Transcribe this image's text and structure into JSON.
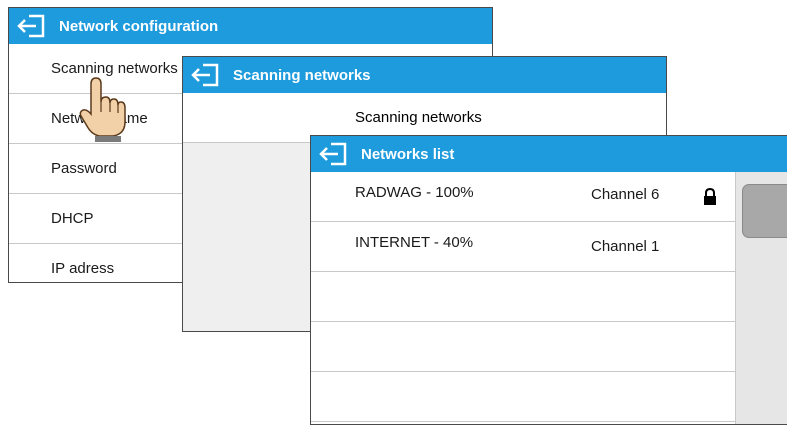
{
  "panels": {
    "network_config": {
      "title": "Network configuration",
      "items": [
        {
          "label": "Scanning networks"
        },
        {
          "label": "Network name"
        },
        {
          "label": "Password"
        },
        {
          "label": "DHCP"
        },
        {
          "label": "IP adress"
        }
      ]
    },
    "scanning": {
      "title": "Scanning networks",
      "status": "Scanning networks"
    },
    "networks_list": {
      "title": "Networks list",
      "networks": [
        {
          "name": "RADWAG - 100%",
          "channel": "Channel 6",
          "secured": true
        },
        {
          "name": "INTERNET - 40%",
          "channel": "Channel 1",
          "secured": false
        }
      ]
    }
  },
  "icons": {
    "back": "back-arrow-icon",
    "lock": "lock-icon",
    "pointer": "hand-pointer-icon"
  },
  "colors": {
    "titlebar": "#1e9bdc",
    "text": "#1a1a1a"
  }
}
